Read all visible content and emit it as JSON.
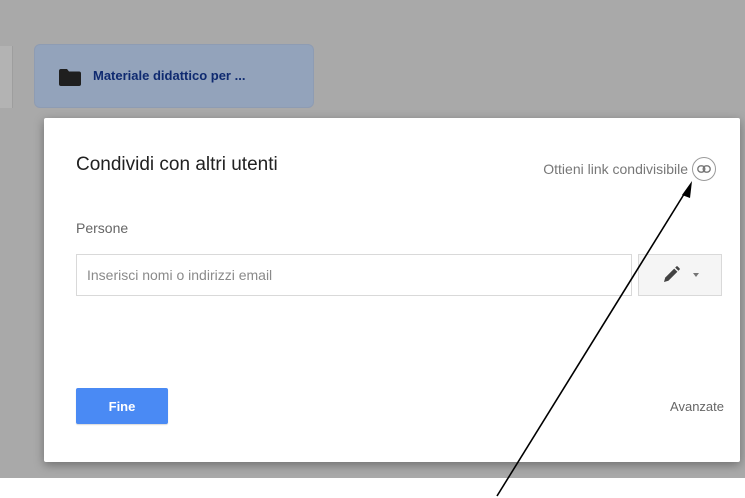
{
  "background": {
    "folder": {
      "name": "Materiale didattico per ...",
      "icon": "folder-icon"
    }
  },
  "dialog": {
    "title": "Condividi con altri utenti",
    "share_link_label": "Ottieni link condivisibile",
    "share_link_icon": "link-icon",
    "people_label": "Persone",
    "people_input": {
      "placeholder": "Inserisci nomi o indirizzi email",
      "value": ""
    },
    "permission_icon": "pencil-icon",
    "done_label": "Fine",
    "advanced_label": "Avanzate"
  },
  "colors": {
    "overlay": "#a9a9a9",
    "primary_button": "#4a8af4",
    "folder_tile": "#93a3bb",
    "folder_text": "#0f2a70"
  }
}
